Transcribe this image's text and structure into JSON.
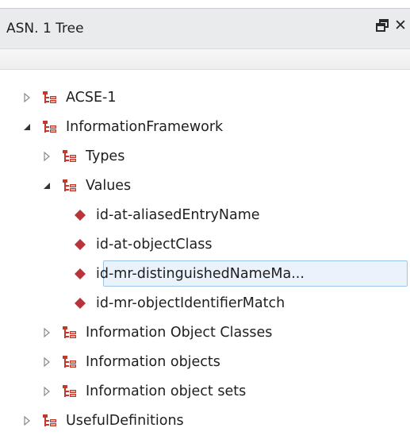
{
  "panel": {
    "title": "ASN. 1 Tree",
    "float_button": "float-icon",
    "close_button": "✕"
  },
  "tree": [
    {
      "label": "ACSE-1",
      "depth": 0,
      "kind": "module",
      "state": "collapsed"
    },
    {
      "label": "InformationFramework",
      "depth": 0,
      "kind": "module",
      "state": "expanded"
    },
    {
      "label": "Types",
      "depth": 1,
      "kind": "module",
      "state": "collapsed"
    },
    {
      "label": "Values",
      "depth": 1,
      "kind": "module",
      "state": "expanded"
    },
    {
      "label": "id-at-aliasedEntryName",
      "depth": 2,
      "kind": "value",
      "state": "leaf"
    },
    {
      "label": "id-at-objectClass",
      "depth": 2,
      "kind": "value",
      "state": "leaf"
    },
    {
      "label": "id-mr-distinguishedNameMa...",
      "depth": 2,
      "kind": "value",
      "state": "leaf",
      "selected": true
    },
    {
      "label": "id-mr-objectIdentifierMatch",
      "depth": 2,
      "kind": "value",
      "state": "leaf"
    },
    {
      "label": "Information Object Classes",
      "depth": 1,
      "kind": "module",
      "state": "collapsed"
    },
    {
      "label": "Information objects",
      "depth": 1,
      "kind": "module",
      "state": "collapsed"
    },
    {
      "label": "Information object sets",
      "depth": 1,
      "kind": "module",
      "state": "collapsed"
    },
    {
      "label": "UsefulDefinitions",
      "depth": 0,
      "kind": "module",
      "state": "collapsed"
    }
  ],
  "colors": {
    "module_icon": "#c0392b",
    "value_icon": "#b8343a",
    "selection_border": "#9bc4e8",
    "selection_fill": "#eaf3fc"
  }
}
